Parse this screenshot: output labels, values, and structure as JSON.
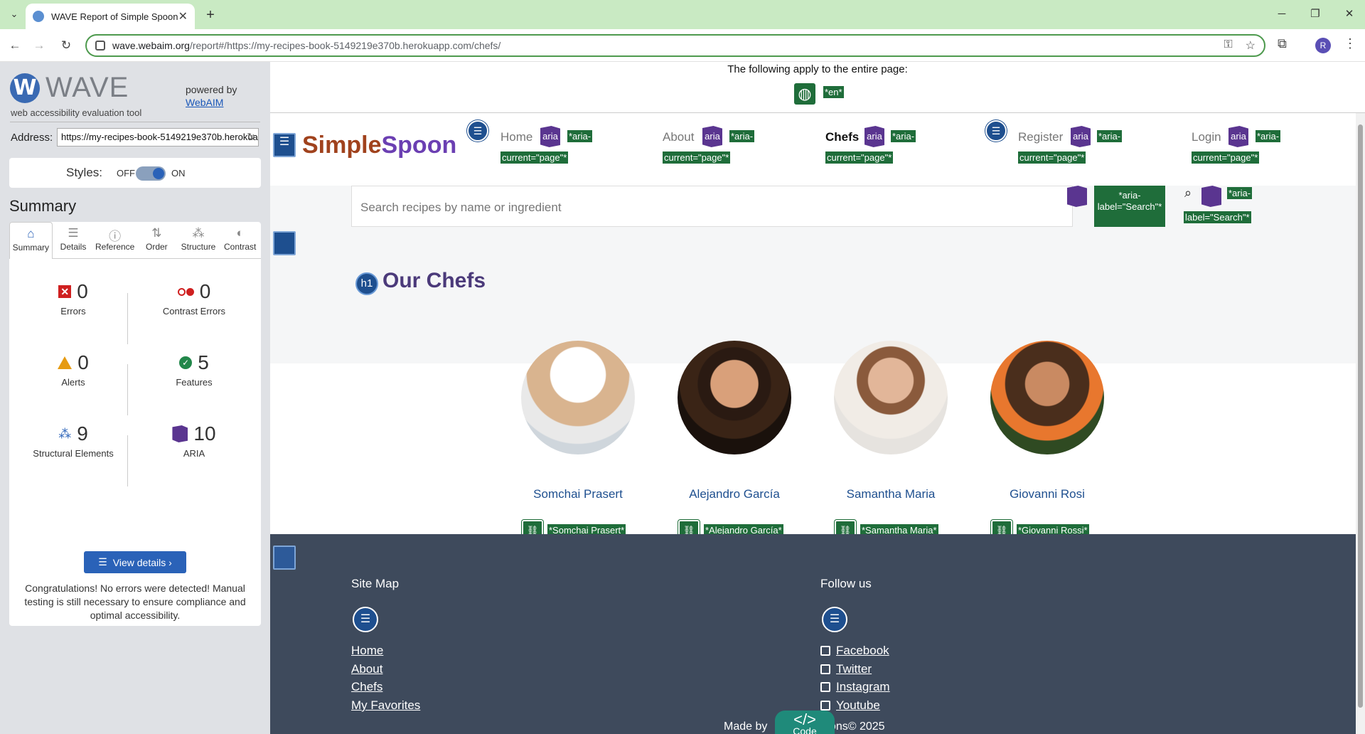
{
  "browser": {
    "tab_title": "WAVE Report of Simple Spoon",
    "url_host": "wave.webaim.org",
    "url_rest": "/report#/https://my-recipes-book-5149219e370b.herokuapp.com/chefs/",
    "profile_initial": "R"
  },
  "wave": {
    "name": "WAVE",
    "subtitle": "web accessibility evaluation tool",
    "powered_by": "powered by",
    "webaim": "WebAIM",
    "address_label": "Address:",
    "address_value": "https://my-recipes-book-5149219e370b.herokuapp.com/chefs/",
    "styles_label": "Styles:",
    "styles_off": "OFF",
    "styles_on": "ON",
    "summary_heading": "Summary",
    "tabs": [
      {
        "label": "Summary",
        "icon": "home-icon"
      },
      {
        "label": "Details",
        "icon": "list-icon"
      },
      {
        "label": "Reference",
        "icon": "info-icon"
      },
      {
        "label": "Order",
        "icon": "order-icon"
      },
      {
        "label": "Structure",
        "icon": "structure-icon"
      },
      {
        "label": "Contrast",
        "icon": "contrast-icon"
      }
    ],
    "stats": {
      "errors": {
        "count": "0",
        "label": "Errors"
      },
      "contrast": {
        "count": "0",
        "label": "Contrast Errors"
      },
      "alerts": {
        "count": "0",
        "label": "Alerts"
      },
      "features": {
        "count": "5",
        "label": "Features"
      },
      "structural": {
        "count": "9",
        "label": "Structural Elements"
      },
      "aria": {
        "count": "10",
        "label": "ARIA"
      }
    },
    "view_details": "View details ›",
    "congrats": "Congratulations! No errors were detected! Manual testing is still necessary to ensure compliance and optimal accessibility."
  },
  "page": {
    "apply_text": "The following apply to the entire page:",
    "lang_tag": "*en*",
    "brand_a": "Simple",
    "brand_b": "Spoon",
    "aria_text": "aria",
    "aria_current_1": "*aria-",
    "aria_current_2": "current=\"page\"*",
    "nav": [
      "Home",
      "About",
      "Chefs",
      "Register",
      "Login"
    ],
    "search_placeholder": "Search recipes by name or ingredient",
    "search_green_1": "*aria-",
    "search_green_2": "label=\"Search\"*",
    "search_tag_1": "*aria-",
    "search_tag_2": "label=\"Search\"*",
    "h1_badge": "h1",
    "h1_title": "Our Chefs",
    "chefs": [
      {
        "name": "Somchai Prasert",
        "alt": "*Somchai Prasert*"
      },
      {
        "name": "Alejandro García",
        "alt": "*Alejandro García*"
      },
      {
        "name": "Samantha Maria",
        "alt": "*Samantha Maria*"
      },
      {
        "name": "Giovanni Rosi",
        "alt": "*Giovanni Rossi*"
      }
    ],
    "footer": {
      "sitemap_heading": "Site Map",
      "sitemap_links": [
        "Home",
        "About",
        "Chefs",
        "My Favorites"
      ],
      "follow_heading": "Follow us",
      "follow_links": [
        "Facebook",
        "Twitter",
        "Instagram",
        "Youtube"
      ],
      "made_by": "Made by",
      "made_tail": "ions© 2025",
      "code_icon": "</>",
      "code_label": "Code"
    }
  }
}
